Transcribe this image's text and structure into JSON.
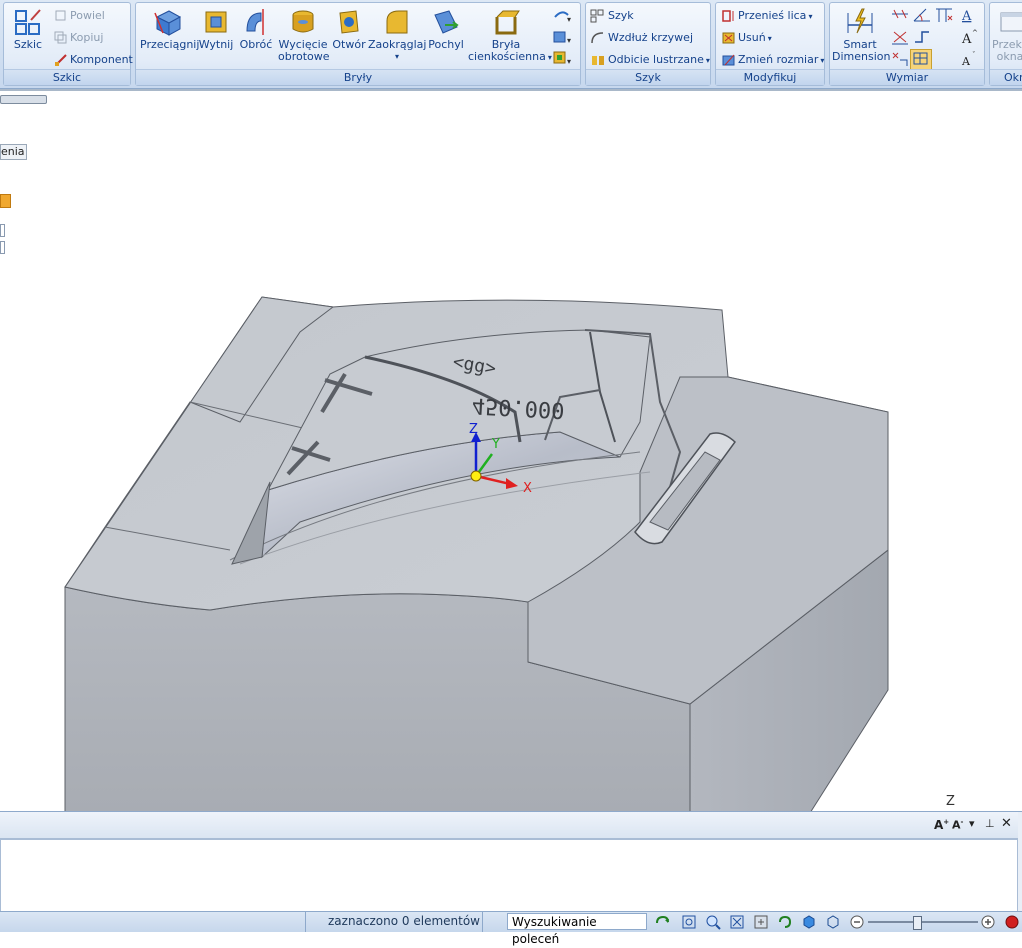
{
  "ribbon": {
    "sketch_group": {
      "label": "Szkic",
      "sketch_button": "Szkic",
      "repeat": "Powiel",
      "copy": "Kopiuj",
      "component": "Komponent"
    },
    "solids_group": {
      "label": "Bryły",
      "extrude": "Przeciągnij",
      "cut": "Wytnij",
      "revolve": "Obróć",
      "revolve_cut_1": "Wycięcie",
      "revolve_cut_2": "obrotowe",
      "hole": "Otwór",
      "round": "Zaokrąglaj",
      "draft": "Pochyl",
      "thin_1": "Bryła",
      "thin_2": "cienkościenna"
    },
    "pattern_group": {
      "label": "Szyk",
      "pattern": "Szyk",
      "along_curve": "Wzdłuż krzywej",
      "mirror": "Odbicie lustrzane"
    },
    "modify_group": {
      "label": "Modyfikuj",
      "move_faces": "Przenieś lica",
      "delete": "Usuń",
      "resize": "Zmień rozmiar"
    },
    "dimension_group": {
      "label": "Wymiar",
      "smart_1": "Smart",
      "smart_2": "Dimension"
    },
    "window_group": {
      "label_partial": "Okn",
      "cut_1": "Przeka",
      "cut_2": "okna"
    }
  },
  "left_panel": {
    "partial_tab": "enia"
  },
  "model": {
    "engraved_text_1": "450.000",
    "engraved_text_2": "<gg>",
    "axis_x": "X",
    "axis_y": "Y",
    "axis_z": "Z",
    "corner_axis_z": "Z"
  },
  "status": {
    "selection": "zaznaczono 0 elementów",
    "search": "Wyszukiwanie poleceń"
  },
  "colors": {
    "ribbon_bg": "#c7d8ee",
    "group_label": "#15428b",
    "model_face_light": "#c9cdd3",
    "model_face_dark": "#a6abb3",
    "axis_x": "#e02020",
    "axis_y": "#20b020",
    "axis_z": "#1020d0"
  }
}
